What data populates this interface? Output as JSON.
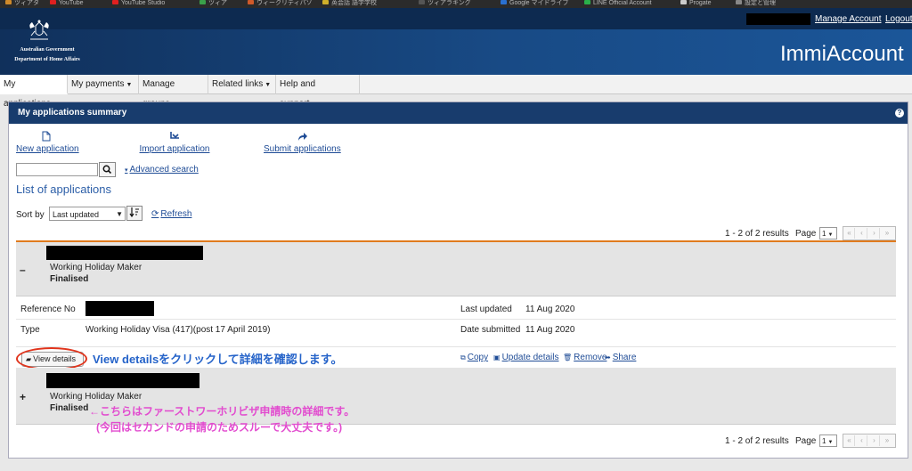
{
  "bookmarks": [
    {
      "label": "ツィアタ",
      "color": "#d08a2a"
    },
    {
      "label": "YouTube",
      "color": "#e02020"
    },
    {
      "label": "YouTube Studio",
      "color": "#e02020"
    },
    {
      "label": "ツィア",
      "color": "#3aa04a"
    },
    {
      "label": "ウィークリティパソ",
      "color": "#d05a2a"
    },
    {
      "label": "英会話 語学学校",
      "color": "#d0b02a"
    },
    {
      "label": "ツィアラキング",
      "color": "#555"
    },
    {
      "label": "Google マイドライブ",
      "color": "#2a70d0"
    },
    {
      "label": "LINE Official Account",
      "color": "#2ab04a"
    },
    {
      "label": "Progate",
      "color": "#ccc"
    },
    {
      "label": "設定と管理",
      "color": "#888"
    }
  ],
  "header": {
    "govt_name": "Australian Government",
    "dept_name": "Department of Home Affairs",
    "app_title": "ImmiAccount",
    "manage_account": "Manage Account",
    "logout": "Logout"
  },
  "nav": {
    "tabs": [
      {
        "label": "My applications",
        "has_menu": false
      },
      {
        "label": "My payments",
        "has_menu": true
      },
      {
        "label": "Manage groups",
        "has_menu": false
      },
      {
        "label": "Related links",
        "has_menu": true
      },
      {
        "label": "Help and support",
        "has_menu": true
      }
    ]
  },
  "panel": {
    "title": "My applications summary",
    "help": "?",
    "actions": {
      "new": "New application",
      "import": "Import application",
      "submit": "Submit applications"
    },
    "search": {
      "placeholder": "",
      "advanced": "Advanced search"
    },
    "list_title": "List of applications",
    "sort": {
      "label": "Sort by",
      "selected": "Last updated",
      "refresh": "Refresh"
    },
    "results": {
      "text": "1 - 2 of 2 results",
      "page_label": "Page",
      "page": "1"
    }
  },
  "applications": [
    {
      "visa_name": "Working Holiday Maker",
      "status": "Finalised",
      "toggle": "–",
      "reference_label": "Reference No",
      "type_label": "Type",
      "type_value": "Working Holiday Visa (417)(post 17 April 2019)",
      "last_updated_label": "Last updated",
      "last_updated": "11 Aug 2020",
      "date_submitted_label": "Date submitted",
      "date_submitted": "11 Aug 2020",
      "view_details": "View details",
      "copy": "Copy",
      "update_details": "Update details",
      "remove": "Remove",
      "share": "Share"
    },
    {
      "visa_name": "Working Holiday Maker",
      "status": "Finalised",
      "toggle": "+"
    }
  ],
  "annotations": {
    "blue": "View detailsをクリックして詳細を確認します。",
    "pink_line1": "←こちらはファーストワーホリビザ申請時の詳細です。",
    "pink_line2": "(今回はセカンドの申請のためスルーで大丈夫です。)",
    "ring_color": "#e0341c"
  },
  "colors": {
    "header": "#184a85",
    "panel_head": "#183c6d",
    "link": "#1f4c96",
    "accent_rule": "#e07b1e"
  }
}
